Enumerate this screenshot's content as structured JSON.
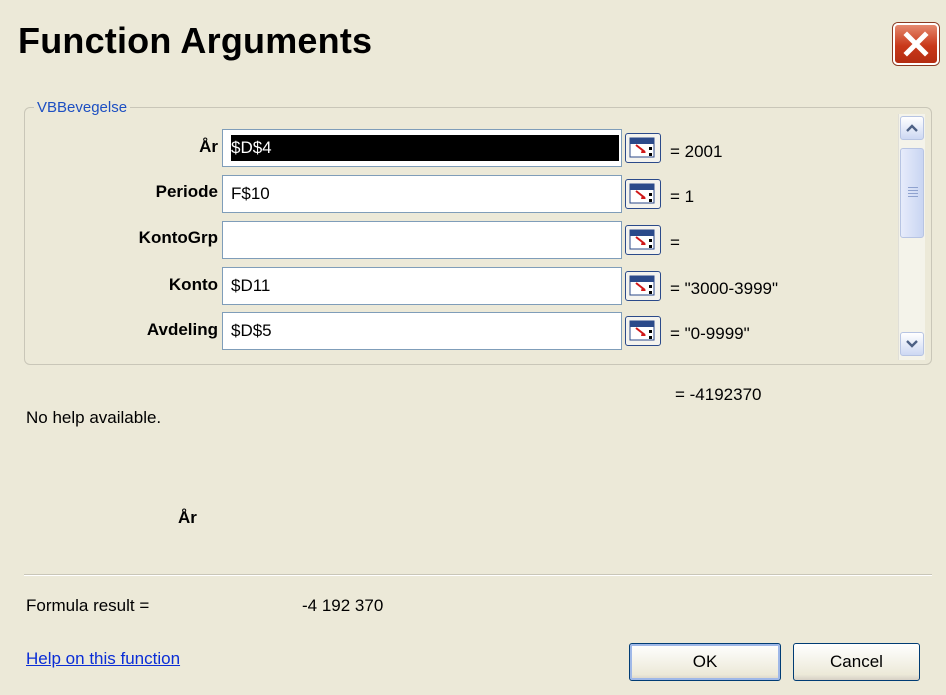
{
  "window": {
    "title": "Function Arguments",
    "close_icon": "close-icon"
  },
  "function": {
    "name": "VBBevegelse",
    "arguments": [
      {
        "label": "År",
        "value": "$D$4",
        "result": "= 2001",
        "selected": true
      },
      {
        "label": "Periode",
        "value": "F$10",
        "result": "= 1",
        "selected": false
      },
      {
        "label": "KontoGrp",
        "value": "",
        "result": "=",
        "selected": false
      },
      {
        "label": "Konto",
        "value": "$D11",
        "result": "= \"3000-3999\"",
        "selected": false
      },
      {
        "label": "Avdeling",
        "value": "$D$5",
        "result": "= \"0-9999\"",
        "selected": false
      }
    ],
    "result": "= -4192370",
    "help": "No help available.",
    "selected_argument": "År"
  },
  "footer": {
    "formula_label": "Formula result =",
    "formula_value": "-4 192 370",
    "help_link": "Help on this function",
    "ok_label": "OK",
    "cancel_label": "Cancel"
  },
  "colors": {
    "dialog_bg": "#ece9d8",
    "close_button": "#c9381a",
    "group_legend": "#1d4fc2",
    "link": "#0a2dd6"
  }
}
